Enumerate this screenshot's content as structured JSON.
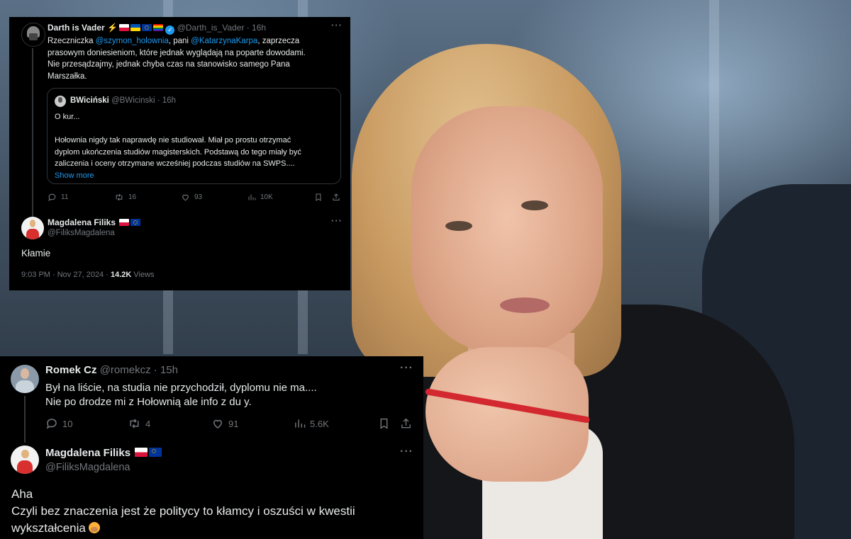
{
  "tweet_top": {
    "author": {
      "name": "Darth is Vader",
      "handle": "@Darth_is_Vader",
      "time": "16h",
      "avatar_icon": "darth-vader-avatar",
      "verified": true
    },
    "text_lines": [
      [
        "Rzeczniczka ",
        "@szymon_holownia",
        ", pani ",
        "@KatarzynaKarpa",
        ",  zaprzecza"
      ],
      [
        "prasowym doniesieniom, które jednak wyglądają na poparte dowodami."
      ],
      [
        "Nie przesądzajmy, jednak chyba czas na stanowisko samego Pana"
      ],
      [
        "Marszałka."
      ]
    ],
    "quote": {
      "name": "BWiciński",
      "handle": "@BWicinski",
      "time": "16h",
      "lines": [
        "O kur...",
        "",
        "Hołownia nigdy tak naprawdę nie studiował. Miał po prostu otrzymać",
        "dyplom ukończenia studiów magisterskich. Podstawą do tego miały być",
        "zaliczenia i oceny otrzymane wcześniej podczas studiów na SWPS...."
      ],
      "show_more": "Show more"
    },
    "stats": {
      "replies": "11",
      "reposts": "16",
      "likes": "93",
      "views": "10K"
    }
  },
  "reply_top": {
    "name": "Magdalena Filiks",
    "handle": "@FiliksMagdalena",
    "text": "Kłamie",
    "date": "9:03 PM · Nov 27, 2024 · ",
    "views_count": "14.2K",
    "views_label": " Views"
  },
  "tweet_bottom": {
    "author": {
      "name": "Romek Cz",
      "handle": "@romekcz",
      "time": "15h"
    },
    "lines": [
      "Był na liście, na studia nie przychodził, dyplomu nie ma....",
      "Nie po drodze mi z Hołownią ale info z du   y."
    ],
    "stats": {
      "replies": "10",
      "reposts": "4",
      "likes": "91",
      "views": "5.6K"
    }
  },
  "reply_bottom": {
    "name": "Magdalena Filiks",
    "handle": "@FiliksMagdalena",
    "lines": [
      "Aha",
      "Czyli bez znaczenia jest że politycy to kłamcy i oszuści w kwestii",
      "wykształcenia"
    ]
  },
  "colors": {
    "background": "#000000",
    "text": "#e7e9ea",
    "muted": "#71767b",
    "link": "#1d9bf0"
  }
}
